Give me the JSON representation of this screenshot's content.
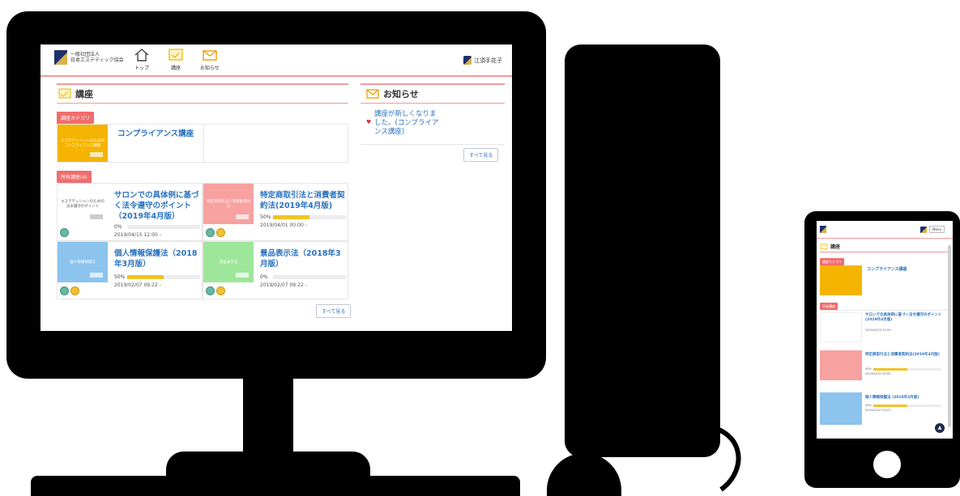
{
  "header": {
    "logo_line1": "一般社団法人",
    "logo_line2": "日本エステティック協会",
    "nav": [
      {
        "label": "トップ",
        "icon": "home-icon"
      },
      {
        "label": "講座",
        "icon": "course-icon"
      },
      {
        "label": "お知らせ",
        "icon": "mail-icon"
      }
    ],
    "user_name": "江須手花子"
  },
  "courses_panel": {
    "title": "講座",
    "category_tag": "講座カテゴリ",
    "category_name": "コンプライアンス講座",
    "category_thumb_text": "エステティシャンのためのコンプライアンス講座",
    "enrolled_tag": "所有講座(4)",
    "courses": [
      {
        "title": "サロンでの具体例に基づく法令遵守のポイント（2019年4月版）",
        "progress_label": "0%",
        "progress": 0,
        "date": "2019/04/15 12:00 -",
        "thumb_text": "エステティシャンのための法令遵守のポイント",
        "thumb_color": "#ffffff"
      },
      {
        "title": "特定商取引法と消費者契約法(2019年4月版)",
        "progress_label": "50%",
        "progress": 50,
        "date": "2019/04/01 00:00 -",
        "thumb_text": "特定商取引法と消費者契約法",
        "thumb_color": "#f7a1a1"
      },
      {
        "title": "個人情報保護法（2018年3月版）",
        "progress_label": "50%",
        "progress": 50,
        "date": "2019/02/07 09:22 -",
        "thumb_text": "個人情報保護法",
        "thumb_color": "#8cc4ee"
      },
      {
        "title": "景品表示法（2018年3月版）",
        "progress_label": "0%",
        "progress": 0,
        "date": "2019/02/07 09:22 -",
        "thumb_text": "景品表示法",
        "thumb_color": "#9ee69a"
      }
    ],
    "see_all": "すべて見る"
  },
  "news_panel": {
    "title": "お知らせ",
    "item": "講座が新しくなりました。(コンプライアンス講座)",
    "see_all": "すべて見る"
  },
  "mobile": {
    "menu_button": "Menu",
    "title": "講座",
    "category_tag": "講座カテゴリ",
    "category_name": "コンプライアンス講座",
    "enrolled_tag": "所有講座",
    "courses": [
      {
        "title": "サロンでの具体例に基づく法令遵守のポイント (2019年4月版)",
        "date": "2019/04/15 12:00 -"
      },
      {
        "title": "特定商取引法と消費者契約法(2019年4月版)",
        "progress_label": "50%",
        "date": "2019/04/01 00:00 -"
      },
      {
        "title": "個人情報保護法 (2018年3月版)",
        "progress_label": "50%",
        "date": "2019/02/07 09:22 -"
      }
    ]
  },
  "colors": {
    "accent_red": "#f06d6d",
    "rule_pink": "#f29a9a",
    "link_blue": "#2a72bf",
    "progress_yellow": "#f0c325",
    "category_yellow": "#f5b400"
  }
}
